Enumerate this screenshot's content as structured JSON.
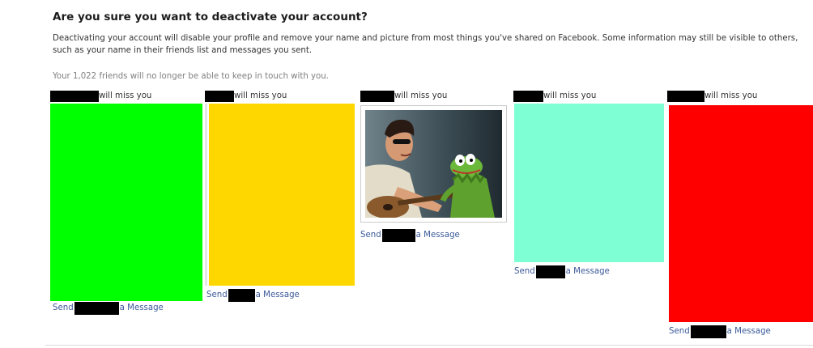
{
  "dialog": {
    "title": "Are you sure you want to deactivate your account?",
    "description": "Deactivating your account will disable your profile and remove your name and picture from most things you've shared on Facebook. Some information may still be visible to others, such as your name in their friends list and messages you sent.",
    "friends_notice": "Your 1,022 friends will no longer be able to keep in touch with you."
  },
  "friends": [
    {
      "miss_label": "will miss you",
      "send_label": "Send",
      "message_label": "a Message",
      "tile_color": "#00ff00",
      "tile": "solid"
    },
    {
      "miss_label": "will miss you",
      "send_label": "Send",
      "message_label": "a Message",
      "tile_color": "#ffd700",
      "tile": "solid"
    },
    {
      "miss_label": "will miss you",
      "send_label": "Send",
      "message_label": "a Message",
      "tile_color": "#ffffff",
      "tile": "photo"
    },
    {
      "miss_label": "will miss you",
      "send_label": "Send",
      "message_label": "a Message",
      "tile_color": "#7fffd4",
      "tile": "solid"
    },
    {
      "miss_label": "will miss you",
      "send_label": "Send",
      "message_label": "a Message",
      "tile_color": "#ff0000",
      "tile": "solid"
    }
  ],
  "colors": {
    "link": "#3b5998",
    "redaction": "#000000"
  }
}
